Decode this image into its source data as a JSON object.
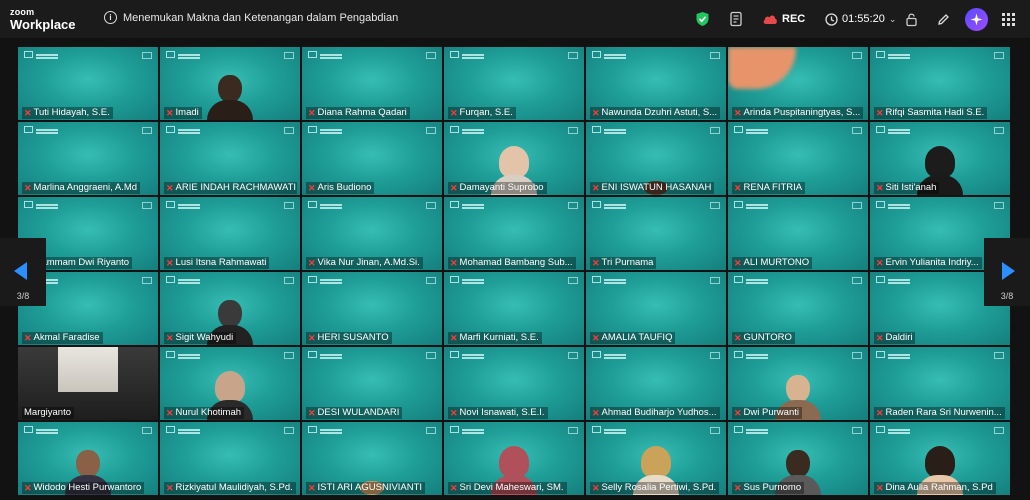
{
  "app": {
    "logo_line1": "zoom",
    "logo_line2": "Workplace"
  },
  "meeting": {
    "title": "Menemukan Makna dan Ketenangan dalam Pengabdian",
    "info_icon": "i"
  },
  "toolbar": {
    "rec_label": "REC",
    "timer": "01:55:20"
  },
  "pager": {
    "left_label": "3/8",
    "right_label": "3/8"
  },
  "colors": {
    "tile_teal": "#1f9e98",
    "mic_muted": "#ff3b3b",
    "arrow_blue": "#2b8fff",
    "shield_green": "#22c55e"
  },
  "participants": [
    {
      "name": "Tuti Hidayah, S.E."
    },
    {
      "name": "Imadi"
    },
    {
      "name": "Diana Rahma Qadari"
    },
    {
      "name": "Furqan, S.E."
    },
    {
      "name": "Nawunda Dzuhri Astuti, S..."
    },
    {
      "name": "Arinda Puspitaningtyas, S..."
    },
    {
      "name": "Rifqi Sasmita Hadi S.E."
    },
    {
      "name": "Marlina Anggraeni, A.Md"
    },
    {
      "name": "ARIE INDAH RACHMAWATI"
    },
    {
      "name": "Aris Budiono"
    },
    {
      "name": "Damayanti Suprobo"
    },
    {
      "name": "ENI ISWATUN HASANAH"
    },
    {
      "name": "RENA FITRIA"
    },
    {
      "name": "Siti Isti'anah"
    },
    {
      "name": "...ammam Dwi Riyanto"
    },
    {
      "name": "Lusi Itsna Rahmawati"
    },
    {
      "name": "Vika Nur Jinan, A.Md.Si."
    },
    {
      "name": "Mohamad Bambang Sub..."
    },
    {
      "name": "Tri Purnama"
    },
    {
      "name": "ALI MURTONO"
    },
    {
      "name": "Ervin Yulianita Indriy..."
    },
    {
      "name": "Akmal Faradise"
    },
    {
      "name": "Sigit Wahyudi"
    },
    {
      "name": "HERI SUSANTO"
    },
    {
      "name": "Marfi Kurniati, S.E."
    },
    {
      "name": "AMALIA TAUFIQ"
    },
    {
      "name": "GUNTORO"
    },
    {
      "name": "Daldiri"
    },
    {
      "name": "Margiyanto"
    },
    {
      "name": "Nurul Khotimah"
    },
    {
      "name": "DESI WULANDARI"
    },
    {
      "name": "Novi Isnawati, S.E.I."
    },
    {
      "name": "Ahmad Budiharjo Yudhos..."
    },
    {
      "name": "Dwi Purwanti"
    },
    {
      "name": "Raden Rara Sri Nurwenin..."
    },
    {
      "name": "Widodo Hesti Purwantoro"
    },
    {
      "name": "Rizkiyatul Maulidiyah, S.Pd."
    },
    {
      "name": "ISTI ARI AGUSNIVIANTI"
    },
    {
      "name": "Sri Devi Maheswari, SM."
    },
    {
      "name": "Selly Rosalia Pertiwi, S.Pd."
    },
    {
      "name": "Sus Purnomo"
    },
    {
      "name": "Dina Aulia Rahman, S.Pd"
    }
  ]
}
